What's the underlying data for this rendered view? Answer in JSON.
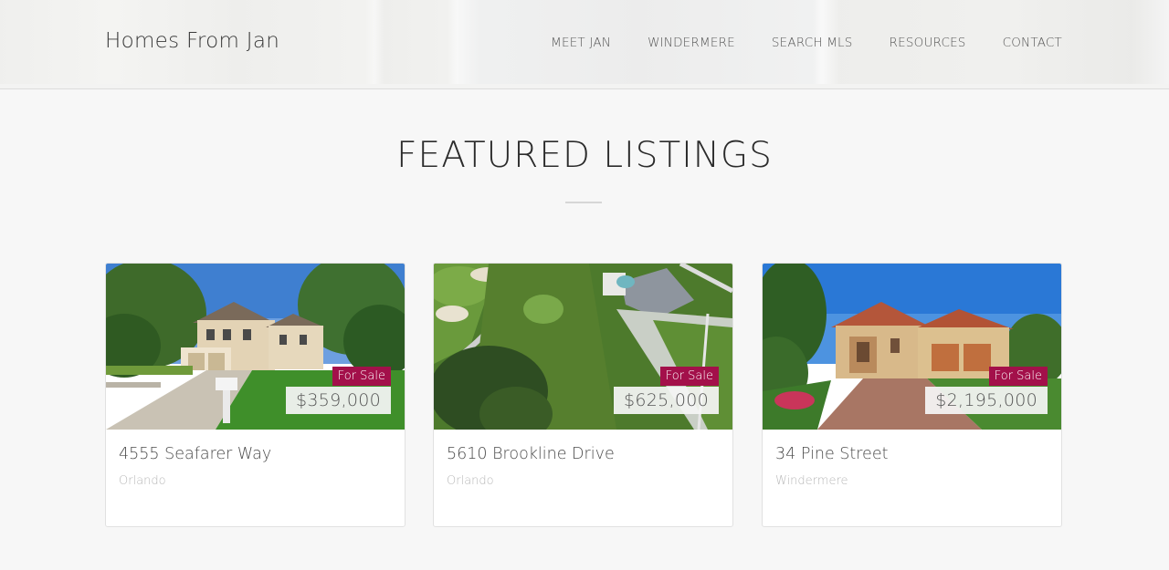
{
  "header": {
    "brand": "Homes From Jan",
    "nav": [
      "MEET JAN",
      "WINDERMERE",
      "SEARCH MLS",
      "RESOURCES",
      "CONTACT"
    ]
  },
  "section": {
    "title": "FEATURED LISTINGS"
  },
  "listings": [
    {
      "status": "For Sale",
      "price": "$359,000",
      "address": "4555 Seafarer Way",
      "city": "Orlando",
      "photo": "two-story-house-photo"
    },
    {
      "status": "For Sale",
      "price": "$625,000",
      "address": "5610 Brookline Drive",
      "city": "Orlando",
      "photo": "aerial-golf-course-photo"
    },
    {
      "status": "For Sale",
      "price": "$2,195,000",
      "address": "34 Pine Street",
      "city": "Windermere",
      "photo": "mediterranean-villa-photo"
    }
  ],
  "colors": {
    "status_badge": "#a3104a",
    "background": "#f7f7f7"
  }
}
